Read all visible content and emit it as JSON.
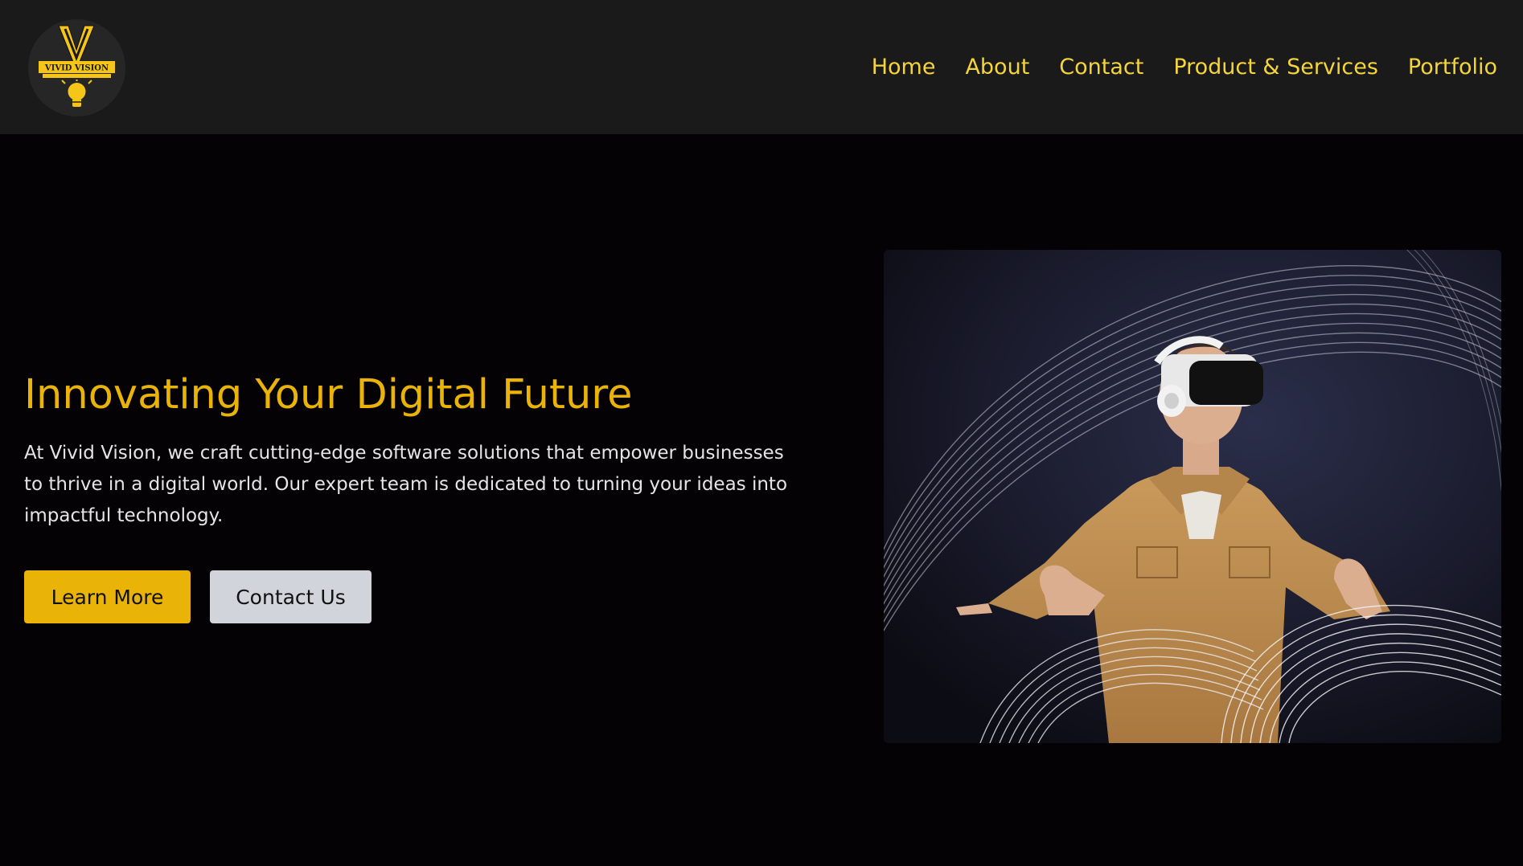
{
  "header": {
    "logo": {
      "wordmark": "VIVID VISION",
      "tagline": "Not the Idea and set thems for Others"
    },
    "nav": [
      {
        "label": "Home"
      },
      {
        "label": "About"
      },
      {
        "label": "Contact"
      },
      {
        "label": "Product & Services"
      },
      {
        "label": "Portfolio"
      }
    ]
  },
  "hero": {
    "title": "Innovating Your Digital Future",
    "description": "At Vivid Vision, we craft cutting-edge software solutions that empower businesses to thrive in a digital world. Our expert team is dedicated to turning your ideas into impactful technology.",
    "buttons": {
      "primary": "Learn More",
      "secondary": "Contact Us"
    },
    "image": {
      "subject": "person-wearing-vr-headset-with-light-trails"
    }
  },
  "colors": {
    "accent": "#eab308",
    "nav_text": "#f5d53c",
    "navbar_bg": "#1a1a1a",
    "page_bg": "#050205",
    "secondary_button": "#d1d5db"
  }
}
